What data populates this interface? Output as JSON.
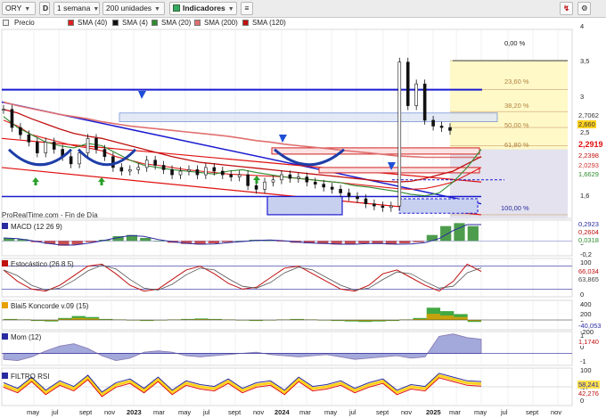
{
  "toolbar": {
    "symbol": "ORY",
    "period": "1 semana",
    "units": "200 unidades",
    "indicators": "Indicadores"
  },
  "legend": [
    {
      "label": "Precio",
      "color": "#ffffff"
    },
    {
      "label": "SMA (40)",
      "color": "#e02020"
    },
    {
      "label": "SMA (4)",
      "color": "#111111"
    },
    {
      "label": "SMA (20)",
      "color": "#2e8b2e"
    },
    {
      "label": "SMA (200)",
      "color": "#e07070"
    },
    {
      "label": "SMA (120)",
      "color": "#c01010"
    }
  ],
  "source_text": "ProRealTime.com - Fin de Día",
  "chart_data": [
    {
      "type": "line",
      "pane": "price",
      "yticks": [
        "4",
        "3,5",
        "3",
        "2,5",
        "1,6"
      ],
      "x": [
        "may",
        "jul",
        "sept",
        "nov",
        "2023",
        "mar",
        "may",
        "jul",
        "sept",
        "nov",
        "2024",
        "mar",
        "may",
        "jul",
        "sept",
        "nov",
        "2025",
        "mar",
        "may",
        "jul",
        "sept",
        "nov"
      ],
      "price": [
        2.95,
        2.7,
        2.6,
        2.5,
        2.35,
        2.5,
        2.4,
        2.3,
        2.2,
        2.35,
        2.55,
        2.4,
        2.3,
        2.15,
        2.1,
        2.12,
        2.15,
        2.25,
        2.18,
        2.12,
        2.05,
        2.1,
        2.12,
        2.05,
        2.15,
        2.1,
        2.05,
        2.02,
        2.05,
        1.9,
        1.85,
        1.95,
        1.98,
        2.05,
        2.0,
        2.02,
        1.95,
        1.92,
        1.88,
        1.85,
        1.8,
        1.75,
        1.72,
        1.65,
        1.62,
        1.6,
        1.62,
        3.6,
        3.0,
        3.3,
        2.8,
        2.72,
        2.7,
        2.66
      ],
      "sma200": [
        3.05,
        3.0,
        2.96,
        2.92,
        2.88,
        2.85,
        2.82,
        2.78,
        2.75,
        2.72,
        2.7,
        2.68,
        2.66,
        2.64,
        2.62,
        2.6,
        2.58,
        2.55,
        2.52,
        2.5,
        2.47,
        2.45,
        2.43,
        2.41,
        2.39,
        2.37,
        2.35,
        2.33,
        2.31,
        2.3,
        2.29,
        2.29,
        2.29,
        2.29,
        2.29
      ],
      "sma120": [
        2.95,
        2.9,
        2.82,
        2.75,
        2.68,
        2.62,
        2.58,
        2.55,
        2.5,
        2.45,
        2.4,
        2.35,
        2.3,
        2.26,
        2.22,
        2.2,
        2.18,
        2.16,
        2.14,
        2.12,
        2.1,
        2.08,
        2.06,
        2.04,
        2.02,
        2.0,
        1.98,
        1.96,
        1.95,
        1.96,
        2.0,
        2.05,
        2.1,
        2.2,
        2.3
      ],
      "sma40": [
        2.8,
        2.72,
        2.6,
        2.55,
        2.5,
        2.45,
        2.42,
        2.38,
        2.3,
        2.25,
        2.2,
        2.18,
        2.15,
        2.12,
        2.1,
        2.08,
        2.06,
        2.05,
        2.04,
        2.03,
        2.02,
        2.0,
        1.98,
        1.96,
        1.94,
        1.92,
        1.9,
        1.88,
        1.86,
        1.85,
        1.86,
        1.9,
        1.95,
        2.05,
        2.15
      ],
      "sma20": [
        2.85,
        2.7,
        2.6,
        2.5,
        2.45,
        2.42,
        2.48,
        2.45,
        2.35,
        2.25,
        2.18,
        2.15,
        2.12,
        2.1,
        2.08,
        2.06,
        2.1,
        2.12,
        2.08,
        2.05,
        2.02,
        2.0,
        1.98,
        1.96,
        1.94,
        1.9,
        1.88,
        1.85,
        1.82,
        1.78,
        1.76,
        1.8,
        1.95,
        2.15,
        2.4
      ],
      "fib_levels": [
        "0,00 %",
        "23,60 %",
        "38,20 %",
        "50,00 %",
        "61,80 %",
        "100,00 %"
      ],
      "value_tags": [
        {
          "text": "2,7062",
          "color": "#333333"
        },
        {
          "text": "2,660",
          "color": "#333333",
          "bg": "#ffd21e"
        },
        {
          "text": "2,2919",
          "color": "#e01010"
        },
        {
          "text": "2,2398",
          "color": "#c01010"
        },
        {
          "text": "2,0293",
          "color": "#d03030"
        },
        {
          "text": "1,6629",
          "color": "#2e8b2e"
        }
      ]
    },
    {
      "type": "bar",
      "pane": "MACD (12 26 9)",
      "yticks": [
        "0",
        "-0,2"
      ],
      "value_tags": [
        {
          "text": "0,2923",
          "color": "#2a2aa0"
        },
        {
          "text": "0,2604",
          "color": "#c01010"
        },
        {
          "text": "0,0318",
          "color": "#2e8b2e"
        }
      ],
      "values": [
        0.05,
        0.03,
        -0.02,
        -0.05,
        -0.08,
        -0.06,
        -0.02,
        0.02,
        0.08,
        0.1,
        0.05,
        0.0,
        -0.03,
        -0.05,
        -0.06,
        -0.04,
        -0.02,
        0.0,
        0.02,
        0.01,
        -0.01,
        -0.03,
        -0.04,
        -0.05,
        -0.06,
        -0.05,
        -0.04,
        -0.05,
        -0.06,
        -0.04,
        -0.02,
        0.1,
        0.25,
        0.3,
        0.25
      ]
    },
    {
      "type": "line",
      "pane": "Estocástico (26 8 5)",
      "yticks": [
        "100",
        "0"
      ],
      "value_tags": [
        {
          "text": "66,034",
          "color": "#c01010"
        },
        {
          "text": "63,865",
          "color": "#444444"
        }
      ],
      "values": [
        70,
        40,
        20,
        15,
        30,
        55,
        80,
        85,
        60,
        30,
        15,
        20,
        45,
        70,
        80,
        60,
        35,
        20,
        25,
        50,
        75,
        80,
        60,
        40,
        20,
        15,
        30,
        60,
        70,
        50,
        30,
        15,
        40,
        85,
        66
      ]
    },
    {
      "type": "bar",
      "pane": "Blai5 Koncorde v.09 (15)",
      "yticks": [
        "400",
        "200",
        "0",
        "-200"
      ],
      "value_tags": [
        {
          "text": "-40,053",
          "color": "#2a2aa0"
        }
      ],
      "values": [
        20,
        10,
        -20,
        -30,
        40,
        80,
        60,
        20,
        10,
        -10,
        -20,
        -10,
        10,
        20,
        30,
        20,
        10,
        -10,
        -20,
        -10,
        10,
        20,
        10,
        -10,
        -20,
        -30,
        -40,
        -30,
        -20,
        10,
        40,
        250,
        180,
        120,
        -40
      ]
    },
    {
      "type": "area",
      "pane": "Mom (12)",
      "yticks": [
        "1",
        "0",
        "-1"
      ],
      "value_tags": [
        {
          "text": "1,1740",
          "color": "#c01010"
        }
      ],
      "values": [
        -0.5,
        -0.6,
        -0.3,
        0.2,
        0.6,
        0.8,
        0.4,
        -0.2,
        -0.6,
        -0.4,
        0.1,
        0.2,
        0.1,
        -0.2,
        -0.3,
        -0.2,
        -0.1,
        0.0,
        0.1,
        -0.1,
        -0.2,
        -0.3,
        -0.2,
        -0.1,
        -0.3,
        -0.5,
        -0.4,
        -0.3,
        -0.2,
        -0.4,
        -0.3,
        1.4,
        1.6,
        1.3,
        1.17
      ]
    },
    {
      "type": "line",
      "pane": "FILTRO RSI",
      "yticks": [
        "100",
        "50",
        "0"
      ],
      "value_tags": [
        {
          "text": "58,241",
          "color": "#2a2aa0"
        },
        {
          "text": "42,276",
          "color": "#c01010"
        }
      ],
      "values": [
        55,
        40,
        70,
        35,
        60,
        45,
        75,
        30,
        55,
        65,
        40,
        70,
        35,
        60,
        50,
        45,
        65,
        40,
        55,
        60,
        35,
        70,
        45,
        50,
        60,
        40,
        55,
        65,
        35,
        50,
        45,
        80,
        70,
        60,
        58
      ]
    }
  ],
  "x_axis_labels": [
    "may",
    "jul",
    "sept",
    "nov",
    "2023",
    "mar",
    "may",
    "jul",
    "sept",
    "nov",
    "2024",
    "mar",
    "may",
    "jul",
    "sept",
    "nov",
    "2025",
    "mar",
    "may",
    "jul",
    "sept",
    "nov"
  ],
  "bold_x_labels": [
    "2023",
    "2024",
    "2025"
  ],
  "colors": {
    "accent_blue": "#1a1ad0",
    "grid": "#e6e6e6",
    "candle": "#111111",
    "fib_fill": "#fff9c8",
    "bull_arrow": "#28a028",
    "pattern_arrow": "#1e4fd6"
  }
}
